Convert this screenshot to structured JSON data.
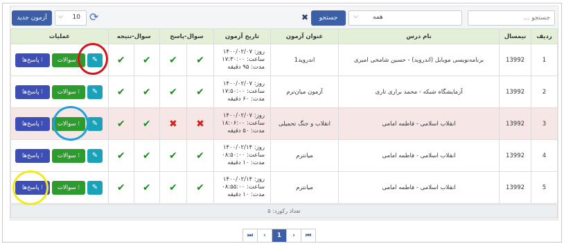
{
  "toolbar": {
    "search_placeholder": "جستجو ...",
    "filter_value": "همه",
    "search_label": "جستجو",
    "clear_glyph": "✖",
    "new_exam_label": "آزمون جدید",
    "page_size": "10",
    "refresh_glyph": "⟳"
  },
  "table": {
    "headers": [
      "ردیف",
      "نیمسال",
      "نام درس",
      "عنوان آزمون",
      "تاریخ آزمون",
      "سوال-پاسخ",
      "سوال-نتیجه",
      "عملیات"
    ],
    "rows": [
      {
        "idx": "1",
        "term": "13992",
        "course": "برنامه‌نویسی موبایل (اندروید) - حسین شامخی امیری",
        "title": "اندروید1",
        "date1": "روز: ۱۴۰۰/۰۲/۰۷",
        "date2": "ساعت: ۱۷:۳۰:۰۰",
        "date3": "مدت: ۹۵ دقیقه",
        "qa": [
          "check",
          "check"
        ],
        "qr": [
          "check",
          "check"
        ]
      },
      {
        "idx": "2",
        "term": "13992",
        "course": "آزمایشگاه شبکه - محمد براری تاری",
        "title": "آزمون میان‌ترم",
        "date1": "روز: ۱۴۰۰/۰۲/۰۷",
        "date2": "ساعت: ۱۷:۵۰:۰۰",
        "date3": "مدت: ۶۰ دقیقه",
        "qa": [
          "check",
          "check"
        ],
        "qr": [
          "check",
          "check"
        ]
      },
      {
        "idx": "3",
        "term": "13992",
        "course": "انقلاب اسلامی - فاطمه امامی",
        "title": "انقلاب و جنگ تحمیلی",
        "date1": "روز: ۱۴۰۰/۰۲/۰۷",
        "date2": "ساعت: ۱۸:۰۶:۰۰",
        "date3": "مدت: ۵۰ دقیقه",
        "qa": [
          "cross",
          "cross"
        ],
        "qr": [
          "check",
          "check"
        ]
      },
      {
        "idx": "4",
        "term": "13992",
        "course": "انقلاب اسلامی - فاطمه امامی",
        "title": "میانترم",
        "date1": "روز: ۱۴۰۰/۰۲/۱۴",
        "date2": "ساعت: ۰۸:۵۰:۰۰",
        "date3": "مدت: ۱۰ دقیقه",
        "qa": [
          "check",
          "check"
        ],
        "qr": [
          "check",
          "check"
        ]
      },
      {
        "idx": "5",
        "term": "13992",
        "course": "انقلاب اسلامی - فاطمه امامی",
        "title": "میانترم",
        "date1": "روز: ۱۴۰۰/۰۲/۱۴",
        "date2": "ساعت: ۰۸:۵۵:۰۰",
        "date3": "مدت: ۱۰ دقیقه",
        "qa": [
          "check",
          "check"
        ],
        "qr": [
          "check",
          "check"
        ]
      }
    ],
    "answers_label": "پاسخ‌ها ⁝",
    "questions_label": "سوالات ⁝",
    "edit_glyph": "✎",
    "check_glyph": "✔",
    "cross_glyph": "✖",
    "record_count": "تعداد رکورد: ۵"
  },
  "pager": {
    "first": "⏮",
    "prev": "‹",
    "page": "1",
    "next": "›",
    "last": "⏭"
  },
  "colors": {
    "primary": "#3d5fa8",
    "success": "#2e9b2e",
    "info": "#1aa3b8",
    "header_bg": "#e3efd7",
    "highlight_row": "#f6e6e6"
  }
}
